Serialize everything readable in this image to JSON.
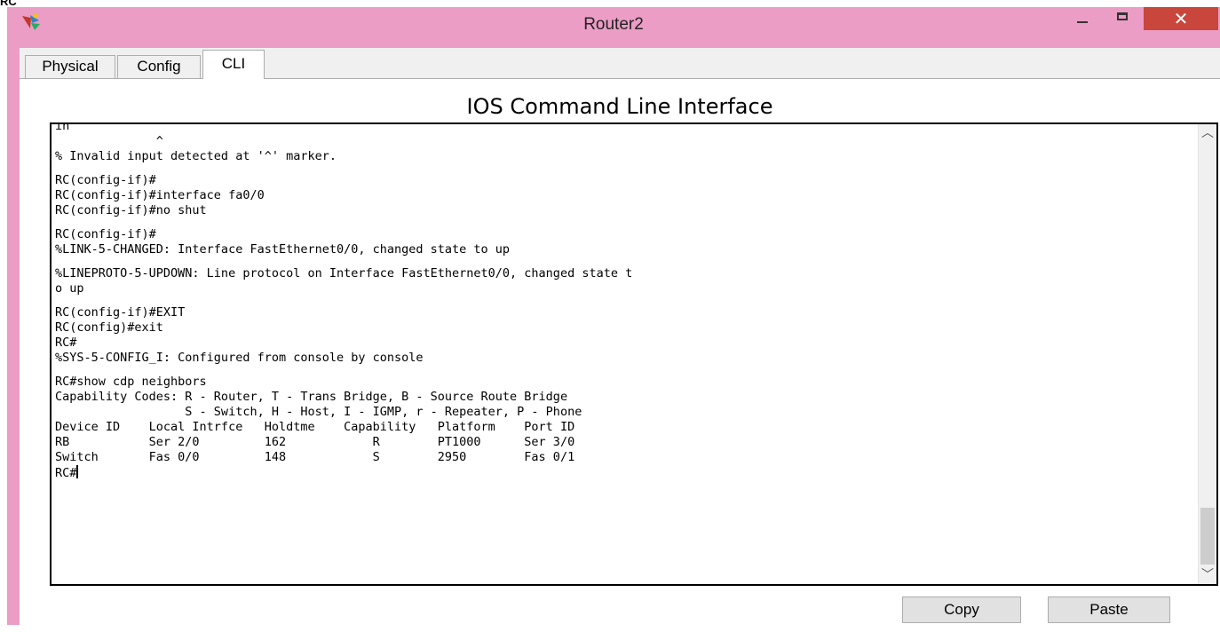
{
  "page": {
    "corner_label": "RC"
  },
  "window": {
    "title": "Router2",
    "close_glyph": "✕",
    "colors": {
      "frame": "#ec9dc5",
      "close_button": "#c9463d"
    },
    "icons": [
      "app-icon",
      "minimize-icon",
      "maximize-icon",
      "close-icon"
    ]
  },
  "tabs": [
    {
      "label": "Physical",
      "active": false
    },
    {
      "label": "Config",
      "active": false
    },
    {
      "label": "CLI",
      "active": true
    }
  ],
  "cli": {
    "heading": "IOS Command Line Interface",
    "lines": [
      "in",
      "              ^",
      "% Invalid input detected at '^' marker.",
      "",
      "RC(config-if)#",
      "RC(config-if)#interface fa0/0",
      "RC(config-if)#no shut",
      "",
      "RC(config-if)#",
      "%LINK-5-CHANGED: Interface FastEthernet0/0, changed state to up",
      "",
      "%LINEPROTO-5-UPDOWN: Line protocol on Interface FastEthernet0/0, changed state t",
      "o up",
      "",
      "RC(config-if)#EXIT",
      "RC(config)#exit",
      "RC#",
      "%SYS-5-CONFIG_I: Configured from console by console",
      "",
      "RC#show cdp neighbors",
      "Capability Codes: R - Router, T - Trans Bridge, B - Source Route Bridge",
      "                  S - Switch, H - Host, I - IGMP, r - Repeater, P - Phone",
      "Device ID    Local Intrfce   Holdtme    Capability   Platform    Port ID",
      "RB           Ser 2/0         162            R        PT1000      Ser 3/0",
      "Switch       Fas 0/0         148            S        2950        Fas 0/1"
    ],
    "prompt": "RC#",
    "scroll_up_glyph": "︿",
    "scroll_down_glyph": "﹀"
  },
  "buttons": {
    "copy": "Copy",
    "paste": "Paste"
  }
}
